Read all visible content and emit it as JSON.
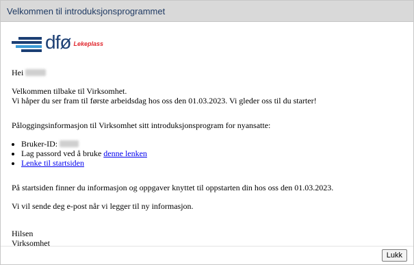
{
  "dialog": {
    "title": "Velkommen til introduksjonsprogrammet",
    "close_label": "Lukk"
  },
  "logo": {
    "text": "dfø",
    "tag": "Lekeplass"
  },
  "message": {
    "greeting": "Hei",
    "welcome_line1": "Velkommen tilbake til Virksomhet.",
    "welcome_line2": "Vi håper du ser fram til første arbeidsdag hos oss den 01.03.2023. Vi gleder oss til du starter!",
    "login_intro": "Påloggingsinformasjon til Virksomhet sitt introduksjonsprogram for nyansatte:",
    "user_id_label": "Bruker-ID:",
    "password_text": "Lag passord ved å bruke",
    "password_link": "denne lenken",
    "start_link": "Lenke til startsiden",
    "info_line": "På startsiden finner du informasjon og oppgaver knyttet til oppstarten din hos oss den 01.03.2023.",
    "notify_line": "Vi vil sende deg e-post når vi legger til ny informasjon.",
    "sign_off": "Hilsen",
    "sender": "Virksomhet"
  }
}
